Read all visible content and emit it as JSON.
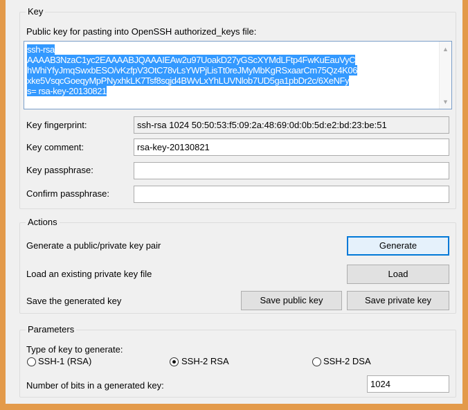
{
  "key_group": {
    "title": "Key",
    "public_key_label": "Public key for pasting into OpenSSH authorized_keys file:",
    "public_key_lines": [
      "ssh-rsa",
      "AAAAB3NzaC1yc2EAAAABJQAAAIEAw2u97UoakD27yGScXYMdLFtp4FwKuEauVyC",
      "hWhiYfyJmqSwxbESO/vKzfpV3OtC78vLsYWPjLisTt0reJMyMbKgRSxaarCm75Qz4K06",
      "xke5VsqcGoeqyMpPNyxhkLK7Tsf8sqjd4BWvLxYhLUVNlob7UD5ga1pbDr2c/6XeNFy",
      "s= rsa-key-20130821"
    ],
    "fingerprint_label": "Key fingerprint:",
    "fingerprint_value": "ssh-rsa 1024 50:50:53:f5:09:2a:48:69:0d:0b:5d:e2:bd:23:be:51",
    "comment_label": "Key comment:",
    "comment_value": "rsa-key-20130821",
    "passphrase_label": "Key passphrase:",
    "passphrase_value": "",
    "confirm_label": "Confirm passphrase:",
    "confirm_value": ""
  },
  "actions_group": {
    "title": "Actions",
    "generate_text": "Generate a public/private key pair",
    "generate_button": "Generate",
    "load_text": "Load an existing private key file",
    "load_button": "Load",
    "save_text": "Save the generated key",
    "save_public_button": "Save public key",
    "save_private_button": "Save private key"
  },
  "parameters_group": {
    "title": "Parameters",
    "type_label": "Type of key to generate:",
    "options": [
      {
        "label": "SSH-1 (RSA)",
        "checked": false
      },
      {
        "label": "SSH-2 RSA",
        "checked": true
      },
      {
        "label": "SSH-2 DSA",
        "checked": false
      }
    ],
    "bits_label": "Number of bits in a generated key:",
    "bits_value": "1024"
  }
}
